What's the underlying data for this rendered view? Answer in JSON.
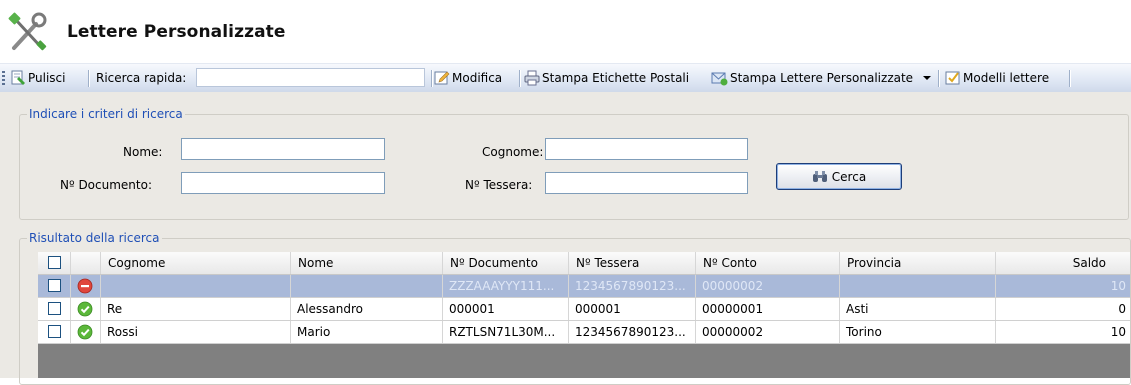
{
  "window": {
    "title": "Lettere Personalizzate",
    "logo_icon": "tools-icon"
  },
  "toolbar": {
    "pulisci_label": "Pulisci",
    "ricerca_label": "Ricerca rapida:",
    "ricerca_value": "",
    "modifica_label": "Modifica",
    "stampa_etichette_label": "Stampa Etichette Postali",
    "stampa_lettere_label": "Stampa Lettere Personalizzate",
    "modelli_label": "Modelli lettere"
  },
  "search": {
    "group_title": "Indicare i criteri di ricerca",
    "nome_label": "Nome:",
    "nome_value": "",
    "documento_label": "Nº Documento:",
    "documento_value": "",
    "cognome_label": "Cognome:",
    "cognome_value": "",
    "tessera_label": "Nº Tessera:",
    "tessera_value": "",
    "cerca_label": "Cerca"
  },
  "results": {
    "group_title": "Risultato della ricerca",
    "columns": [
      "Cognome",
      "Nome",
      "Nº Documento",
      "Nº Tessera",
      "Nº Conto",
      "Provincia",
      "Saldo"
    ],
    "rows": [
      {
        "status": "error",
        "selected": true,
        "cognome": "",
        "nome": "",
        "documento": "ZZZAAAYYY111...",
        "tessera": "1234567890123...",
        "conto": "00000002",
        "provincia": "",
        "saldo": "10"
      },
      {
        "status": "ok",
        "selected": false,
        "cognome": "Re",
        "nome": "Alessandro",
        "documento": "000001",
        "tessera": "000001",
        "conto": "00000001",
        "provincia": "Asti",
        "saldo": "0"
      },
      {
        "status": "ok",
        "selected": false,
        "cognome": "Rossi",
        "nome": "Mario",
        "documento": "RZTLSN71L30M...",
        "tessera": "1234567890123...",
        "conto": "00000002",
        "provincia": "Torino",
        "saldo": "10"
      }
    ]
  },
  "colors": {
    "group_title": "#1f4fb6",
    "selected_row": "#a9b9d9",
    "ok_icon": "#5cb83a",
    "error_icon": "#e0463c"
  }
}
